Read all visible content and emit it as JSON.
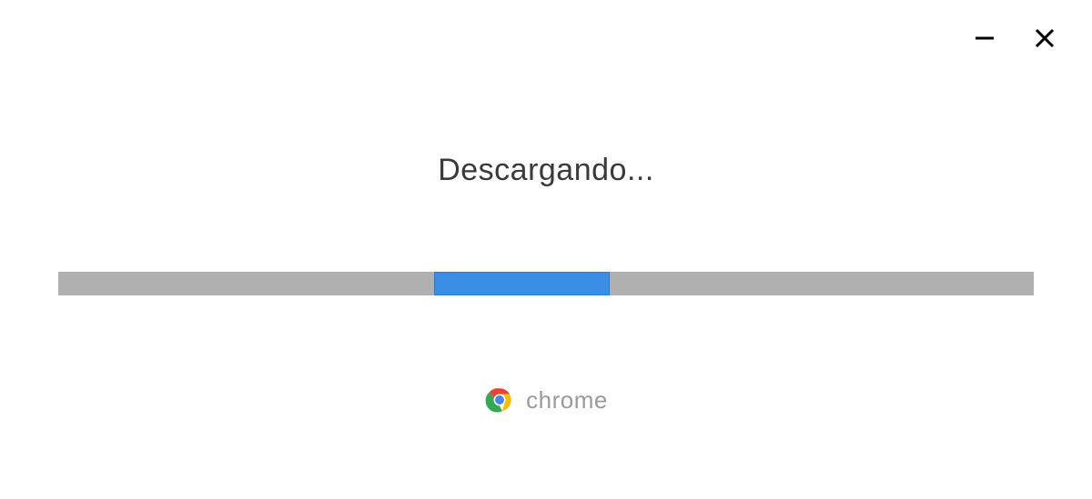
{
  "status": {
    "text": "Descargando..."
  },
  "brand": {
    "label": "chrome"
  },
  "progress": {
    "indeterminate": true
  }
}
